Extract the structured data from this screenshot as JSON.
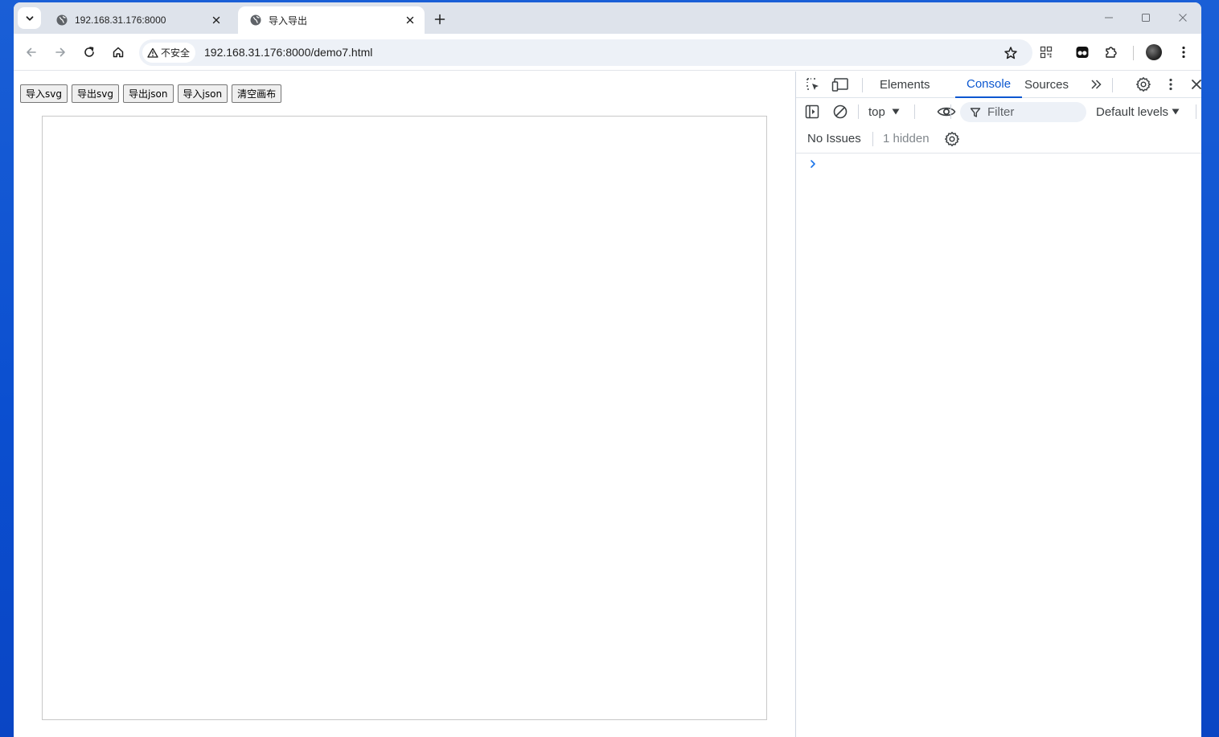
{
  "browser": {
    "tabs": [
      {
        "title": "192.168.31.176:8000",
        "active": false
      },
      {
        "title": "导入导出",
        "active": true
      }
    ],
    "security_label": "不安全",
    "url": "192.168.31.176:8000/demo7.html"
  },
  "page": {
    "buttons": [
      {
        "label": "导入svg"
      },
      {
        "label": "导出svg"
      },
      {
        "label": "导出json"
      },
      {
        "label": "导入json"
      },
      {
        "label": "清空画布"
      }
    ]
  },
  "devtools": {
    "tabs": [
      {
        "label": "Elements",
        "active": false
      },
      {
        "label": "Console",
        "active": true
      },
      {
        "label": "Sources",
        "active": false
      }
    ],
    "context": "top",
    "filter_placeholder": "Filter",
    "levels": "Default levels",
    "issues": "No Issues",
    "hidden": "1 hidden"
  },
  "colors": {
    "accent": "#0b57d0",
    "desktop": "#0b4fd0",
    "tabstrip": "#dee3eb"
  }
}
